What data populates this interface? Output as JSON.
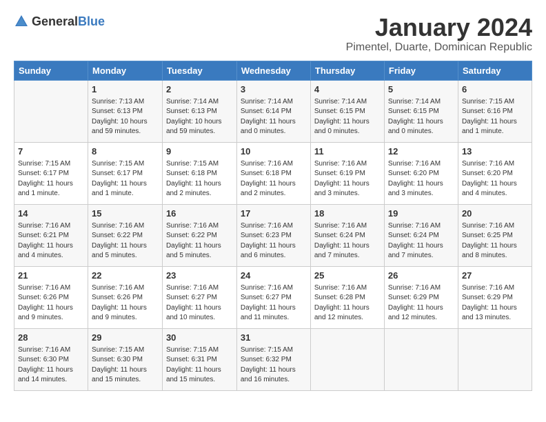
{
  "logo": {
    "general": "General",
    "blue": "Blue"
  },
  "title": "January 2024",
  "subtitle": "Pimentel, Duarte, Dominican Republic",
  "headers": [
    "Sunday",
    "Monday",
    "Tuesday",
    "Wednesday",
    "Thursday",
    "Friday",
    "Saturday"
  ],
  "weeks": [
    [
      {
        "day": "",
        "info": ""
      },
      {
        "day": "1",
        "info": "Sunrise: 7:13 AM\nSunset: 6:13 PM\nDaylight: 10 hours\nand 59 minutes."
      },
      {
        "day": "2",
        "info": "Sunrise: 7:14 AM\nSunset: 6:13 PM\nDaylight: 10 hours\nand 59 minutes."
      },
      {
        "day": "3",
        "info": "Sunrise: 7:14 AM\nSunset: 6:14 PM\nDaylight: 11 hours\nand 0 minutes."
      },
      {
        "day": "4",
        "info": "Sunrise: 7:14 AM\nSunset: 6:15 PM\nDaylight: 11 hours\nand 0 minutes."
      },
      {
        "day": "5",
        "info": "Sunrise: 7:14 AM\nSunset: 6:15 PM\nDaylight: 11 hours\nand 0 minutes."
      },
      {
        "day": "6",
        "info": "Sunrise: 7:15 AM\nSunset: 6:16 PM\nDaylight: 11 hours\nand 1 minute."
      }
    ],
    [
      {
        "day": "7",
        "info": "Sunrise: 7:15 AM\nSunset: 6:17 PM\nDaylight: 11 hours\nand 1 minute."
      },
      {
        "day": "8",
        "info": "Sunrise: 7:15 AM\nSunset: 6:17 PM\nDaylight: 11 hours\nand 1 minute."
      },
      {
        "day": "9",
        "info": "Sunrise: 7:15 AM\nSunset: 6:18 PM\nDaylight: 11 hours\nand 2 minutes."
      },
      {
        "day": "10",
        "info": "Sunrise: 7:16 AM\nSunset: 6:18 PM\nDaylight: 11 hours\nand 2 minutes."
      },
      {
        "day": "11",
        "info": "Sunrise: 7:16 AM\nSunset: 6:19 PM\nDaylight: 11 hours\nand 3 minutes."
      },
      {
        "day": "12",
        "info": "Sunrise: 7:16 AM\nSunset: 6:20 PM\nDaylight: 11 hours\nand 3 minutes."
      },
      {
        "day": "13",
        "info": "Sunrise: 7:16 AM\nSunset: 6:20 PM\nDaylight: 11 hours\nand 4 minutes."
      }
    ],
    [
      {
        "day": "14",
        "info": "Sunrise: 7:16 AM\nSunset: 6:21 PM\nDaylight: 11 hours\nand 4 minutes."
      },
      {
        "day": "15",
        "info": "Sunrise: 7:16 AM\nSunset: 6:22 PM\nDaylight: 11 hours\nand 5 minutes."
      },
      {
        "day": "16",
        "info": "Sunrise: 7:16 AM\nSunset: 6:22 PM\nDaylight: 11 hours\nand 5 minutes."
      },
      {
        "day": "17",
        "info": "Sunrise: 7:16 AM\nSunset: 6:23 PM\nDaylight: 11 hours\nand 6 minutes."
      },
      {
        "day": "18",
        "info": "Sunrise: 7:16 AM\nSunset: 6:24 PM\nDaylight: 11 hours\nand 7 minutes."
      },
      {
        "day": "19",
        "info": "Sunrise: 7:16 AM\nSunset: 6:24 PM\nDaylight: 11 hours\nand 7 minutes."
      },
      {
        "day": "20",
        "info": "Sunrise: 7:16 AM\nSunset: 6:25 PM\nDaylight: 11 hours\nand 8 minutes."
      }
    ],
    [
      {
        "day": "21",
        "info": "Sunrise: 7:16 AM\nSunset: 6:26 PM\nDaylight: 11 hours\nand 9 minutes."
      },
      {
        "day": "22",
        "info": "Sunrise: 7:16 AM\nSunset: 6:26 PM\nDaylight: 11 hours\nand 9 minutes."
      },
      {
        "day": "23",
        "info": "Sunrise: 7:16 AM\nSunset: 6:27 PM\nDaylight: 11 hours\nand 10 minutes."
      },
      {
        "day": "24",
        "info": "Sunrise: 7:16 AM\nSunset: 6:27 PM\nDaylight: 11 hours\nand 11 minutes."
      },
      {
        "day": "25",
        "info": "Sunrise: 7:16 AM\nSunset: 6:28 PM\nDaylight: 11 hours\nand 12 minutes."
      },
      {
        "day": "26",
        "info": "Sunrise: 7:16 AM\nSunset: 6:29 PM\nDaylight: 11 hours\nand 12 minutes."
      },
      {
        "day": "27",
        "info": "Sunrise: 7:16 AM\nSunset: 6:29 PM\nDaylight: 11 hours\nand 13 minutes."
      }
    ],
    [
      {
        "day": "28",
        "info": "Sunrise: 7:16 AM\nSunset: 6:30 PM\nDaylight: 11 hours\nand 14 minutes."
      },
      {
        "day": "29",
        "info": "Sunrise: 7:15 AM\nSunset: 6:30 PM\nDaylight: 11 hours\nand 15 minutes."
      },
      {
        "day": "30",
        "info": "Sunrise: 7:15 AM\nSunset: 6:31 PM\nDaylight: 11 hours\nand 15 minutes."
      },
      {
        "day": "31",
        "info": "Sunrise: 7:15 AM\nSunset: 6:32 PM\nDaylight: 11 hours\nand 16 minutes."
      },
      {
        "day": "",
        "info": ""
      },
      {
        "day": "",
        "info": ""
      },
      {
        "day": "",
        "info": ""
      }
    ]
  ]
}
